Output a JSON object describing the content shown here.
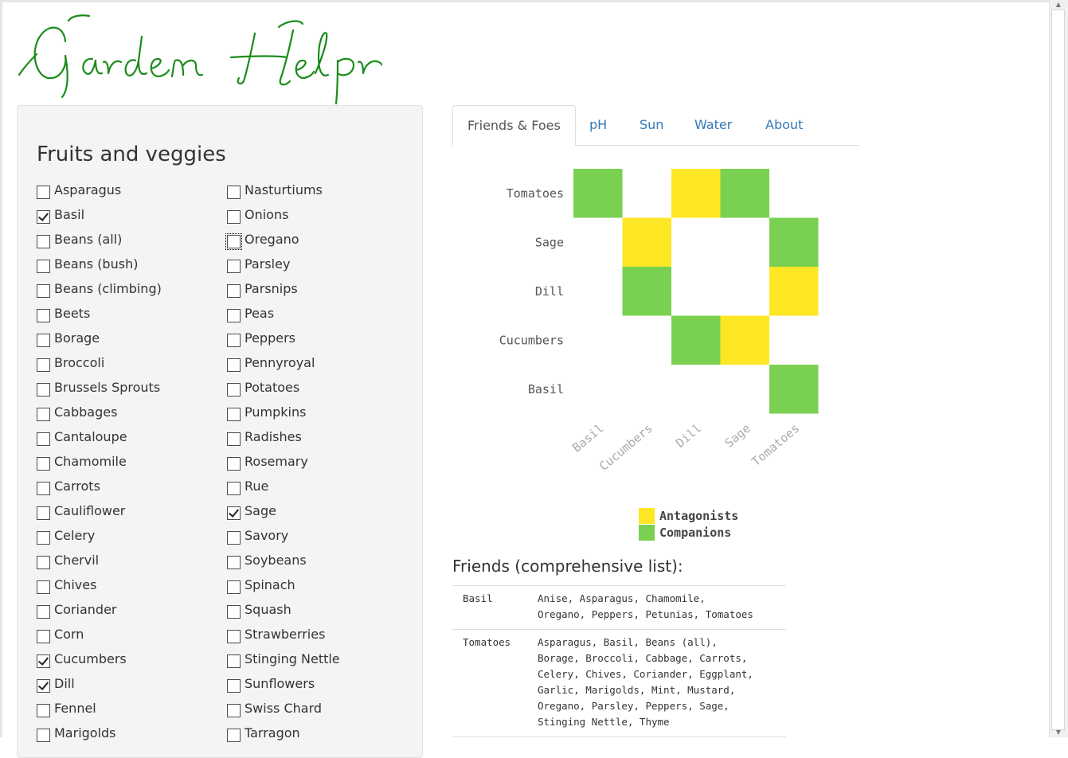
{
  "app": {
    "title": "Garden Helpr",
    "accent_green": "#1a8c1a"
  },
  "panel": {
    "title": "Fruits and veggies",
    "column1": [
      {
        "label": "Asparagus",
        "checked": false
      },
      {
        "label": "Basil",
        "checked": true
      },
      {
        "label": "Beans (all)",
        "checked": false
      },
      {
        "label": "Beans (bush)",
        "checked": false
      },
      {
        "label": "Beans (climbing)",
        "checked": false
      },
      {
        "label": "Beets",
        "checked": false
      },
      {
        "label": "Borage",
        "checked": false
      },
      {
        "label": "Broccoli",
        "checked": false
      },
      {
        "label": "Brussels Sprouts",
        "checked": false
      },
      {
        "label": "Cabbages",
        "checked": false
      },
      {
        "label": "Cantaloupe",
        "checked": false
      },
      {
        "label": "Chamomile",
        "checked": false
      },
      {
        "label": "Carrots",
        "checked": false
      },
      {
        "label": "Cauliflower",
        "checked": false
      },
      {
        "label": "Celery",
        "checked": false
      },
      {
        "label": "Chervil",
        "checked": false
      },
      {
        "label": "Chives",
        "checked": false
      },
      {
        "label": "Coriander",
        "checked": false
      },
      {
        "label": "Corn",
        "checked": false
      },
      {
        "label": "Cucumbers",
        "checked": true
      },
      {
        "label": "Dill",
        "checked": true
      },
      {
        "label": "Fennel",
        "checked": false
      },
      {
        "label": "Marigolds",
        "checked": false
      }
    ],
    "column2": [
      {
        "label": "Nasturtiums",
        "checked": false
      },
      {
        "label": "Onions",
        "checked": false
      },
      {
        "label": "Oregano",
        "checked": false,
        "focused": true
      },
      {
        "label": "Parsley",
        "checked": false
      },
      {
        "label": "Parsnips",
        "checked": false
      },
      {
        "label": "Peas",
        "checked": false
      },
      {
        "label": "Peppers",
        "checked": false
      },
      {
        "label": "Pennyroyal",
        "checked": false
      },
      {
        "label": "Potatoes",
        "checked": false
      },
      {
        "label": "Pumpkins",
        "checked": false
      },
      {
        "label": "Radishes",
        "checked": false
      },
      {
        "label": "Rosemary",
        "checked": false
      },
      {
        "label": "Rue",
        "checked": false
      },
      {
        "label": "Sage",
        "checked": true
      },
      {
        "label": "Savory",
        "checked": false
      },
      {
        "label": "Soybeans",
        "checked": false
      },
      {
        "label": "Spinach",
        "checked": false
      },
      {
        "label": "Squash",
        "checked": false
      },
      {
        "label": "Strawberries",
        "checked": false
      },
      {
        "label": "Stinging Nettle",
        "checked": false
      },
      {
        "label": "Sunflowers",
        "checked": false
      },
      {
        "label": "Swiss Chard",
        "checked": false
      },
      {
        "label": "Tarragon",
        "checked": false
      }
    ]
  },
  "tabs": [
    {
      "label": "Friends & Foes",
      "active": true
    },
    {
      "label": "pH",
      "active": false
    },
    {
      "label": "Sun",
      "active": false
    },
    {
      "label": "Water",
      "active": false
    },
    {
      "label": "About",
      "active": false
    }
  ],
  "chart_data": {
    "type": "heatmap",
    "title": "",
    "rows": [
      "Tomatoes",
      "Sage",
      "Dill",
      "Cucumbers",
      "Basil"
    ],
    "columns": [
      "Basil",
      "Cucumbers",
      "Dill",
      "Sage",
      "Tomatoes"
    ],
    "cells": [
      {
        "row": "Tomatoes",
        "column": "Basil",
        "value": "Companions"
      },
      {
        "row": "Tomatoes",
        "column": "Dill",
        "value": "Antagonists"
      },
      {
        "row": "Tomatoes",
        "column": "Sage",
        "value": "Companions"
      },
      {
        "row": "Sage",
        "column": "Cucumbers",
        "value": "Antagonists"
      },
      {
        "row": "Sage",
        "column": "Tomatoes",
        "value": "Companions"
      },
      {
        "row": "Dill",
        "column": "Cucumbers",
        "value": "Companions"
      },
      {
        "row": "Dill",
        "column": "Tomatoes",
        "value": "Antagonists"
      },
      {
        "row": "Cucumbers",
        "column": "Dill",
        "value": "Companions"
      },
      {
        "row": "Cucumbers",
        "column": "Sage",
        "value": "Antagonists"
      },
      {
        "row": "Basil",
        "column": "Tomatoes",
        "value": "Companions"
      }
    ],
    "legend": [
      {
        "label": "Antagonists",
        "color": "#fde725"
      },
      {
        "label": "Companions",
        "color": "#7ad151"
      }
    ],
    "legend_position": "bottom-right"
  },
  "friends": {
    "title": "Friends (comprehensive list):",
    "rows": [
      {
        "name": "Basil",
        "lines": [
          "Anise, Asparagus, Chamomile,",
          "Oregano, Peppers, Petunias, Tomatoes"
        ]
      },
      {
        "name": "Tomatoes",
        "lines": [
          "Asparagus, Basil, Beans (all),",
          "Borage, Broccoli, Cabbage, Carrots,",
          "Celery, Chives, Coriander, Eggplant,",
          "Garlic, Marigolds, Mint, Mustard,",
          "Oregano, Parsley, Peppers, Sage,",
          "Stinging Nettle, Thyme"
        ]
      }
    ]
  }
}
